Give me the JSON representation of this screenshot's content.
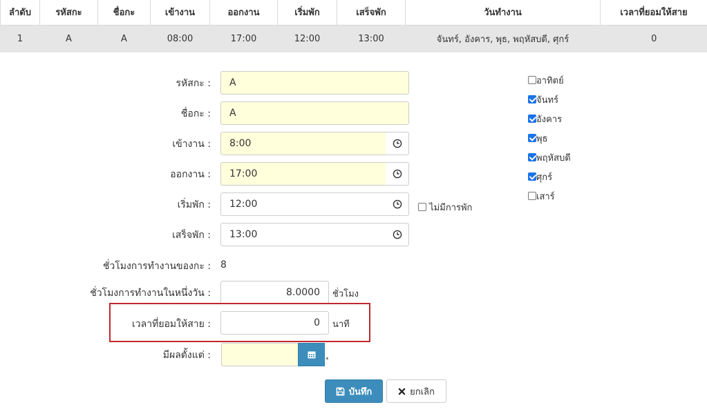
{
  "table": {
    "headers": [
      "ลำดับ",
      "รหัสกะ",
      "ชื่อกะ",
      "เข้างาน",
      "ออกงาน",
      "เริ่มพัก",
      "เสร็จพัก",
      "วันทำงาน",
      "เวลาที่ยอมให้สาย"
    ],
    "rows": [
      [
        "1",
        "A",
        "A",
        "08:00",
        "17:00",
        "12:00",
        "13:00",
        "จันทร์, อังคาร, พุธ, พฤหัสบดี, ศุกร์",
        "0"
      ]
    ]
  },
  "form": {
    "shift_code_label": "รหัสกะ :",
    "shift_code_value": "A",
    "shift_name_label": "ชื่อกะ :",
    "shift_name_value": "A",
    "start_label": "เข้างาน :",
    "start_value": "8:00",
    "end_label": "ออกงาน :",
    "end_value": "17:00",
    "break_start_label": "เริ่มพัก :",
    "break_start_value": "12:00",
    "break_end_label": "เสร็จพัก :",
    "break_end_value": "13:00",
    "no_break_label": "ไม่มีการพัก",
    "no_break_checked": false,
    "work_hours_label": "ชั่วโมงการทำงานของกะ :",
    "work_hours_value": "8",
    "daily_hours_label": "ชั่วโมงการทำงานในหนึ่งวัน :",
    "daily_hours_value": "8.0000",
    "daily_hours_unit": "ชั่วโมง",
    "late_label": "เวลาที่ยอมให้สาย :",
    "late_value": "0",
    "late_unit": "นาที",
    "effective_label": "มีผลตั้งแต่ :",
    "effective_value": "",
    "required_mark": "*"
  },
  "days": [
    {
      "label": "อาทิตย์",
      "checked": false
    },
    {
      "label": "จันทร์",
      "checked": true
    },
    {
      "label": "อังคาร",
      "checked": true
    },
    {
      "label": "พุธ",
      "checked": true
    },
    {
      "label": "พฤหัสบดี",
      "checked": true
    },
    {
      "label": "ศุกร์",
      "checked": true
    },
    {
      "label": "เสาร์",
      "checked": false
    }
  ],
  "buttons": {
    "save_label": "บันทึก",
    "cancel_label": "ยกเลิก"
  },
  "colors": {
    "accent": "#3c8dbc",
    "highlight": "#c0282d",
    "input_bg": "#ffffdb",
    "row_bg": "#e6e6e6"
  }
}
